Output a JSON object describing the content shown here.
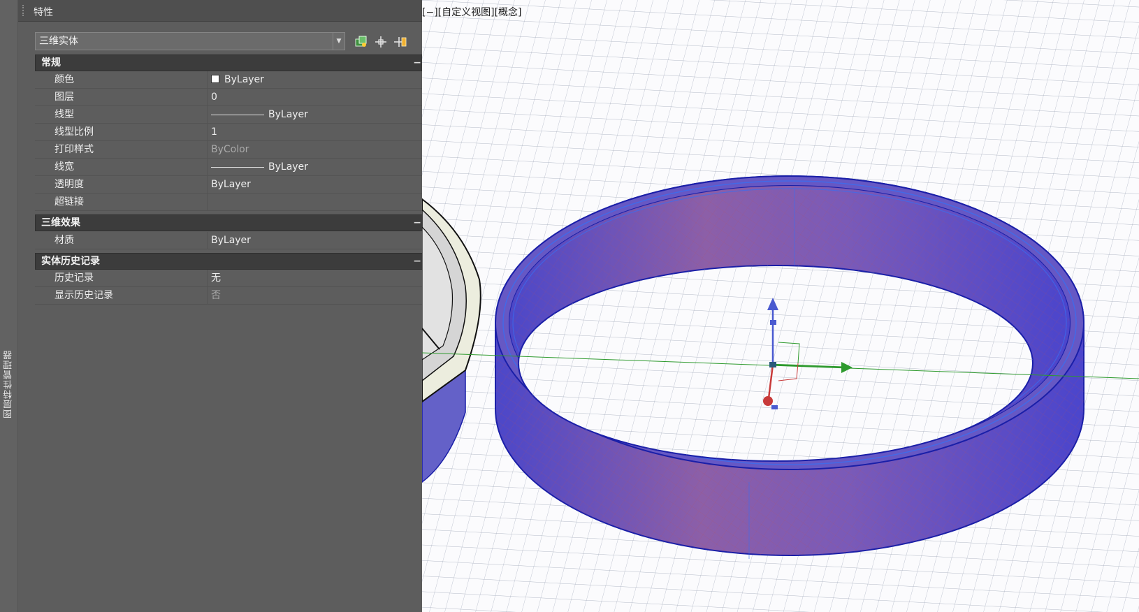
{
  "side_tab": {
    "label": "图层特性管理器"
  },
  "palette": {
    "title": "特性",
    "object_type": "三维实体",
    "toolbar": {
      "quick_select_icon": "quick-select-icon",
      "select_objects_icon": "select-objects-icon",
      "toggle_pickadd_icon": "toggle-pickadd-icon"
    },
    "sections": [
      {
        "title": "常规",
        "toggle": "−",
        "rows": [
          {
            "name": "颜色",
            "value": "ByLayer"
          },
          {
            "name": "图层",
            "value": "0"
          },
          {
            "name": "线型",
            "value": "ByLayer"
          },
          {
            "name": "线型比例",
            "value": "1"
          },
          {
            "name": "打印样式",
            "value": "ByColor"
          },
          {
            "name": "线宽",
            "value": "ByLayer"
          },
          {
            "name": "透明度",
            "value": "ByLayer"
          },
          {
            "name": "超链接",
            "value": ""
          }
        ]
      },
      {
        "title": "三维效果",
        "toggle": "−",
        "rows": [
          {
            "name": "材质",
            "value": "ByLayer"
          }
        ]
      },
      {
        "title": "实体历史记录",
        "toggle": "−",
        "rows": [
          {
            "name": "历史记录",
            "value": "无"
          },
          {
            "name": "显示历史记录",
            "value": "否"
          }
        ]
      }
    ]
  },
  "viewport": {
    "label": "[−][自定义视图][概念]",
    "colors": {
      "solid_fill": "#6a5cc7",
      "solid_edge": "#1a1fa8",
      "grid": "#9aa3b5",
      "x_axis": "#2e9a2e",
      "y_axis": "#4a5ad0",
      "z_axis": "#c83a3a"
    }
  }
}
